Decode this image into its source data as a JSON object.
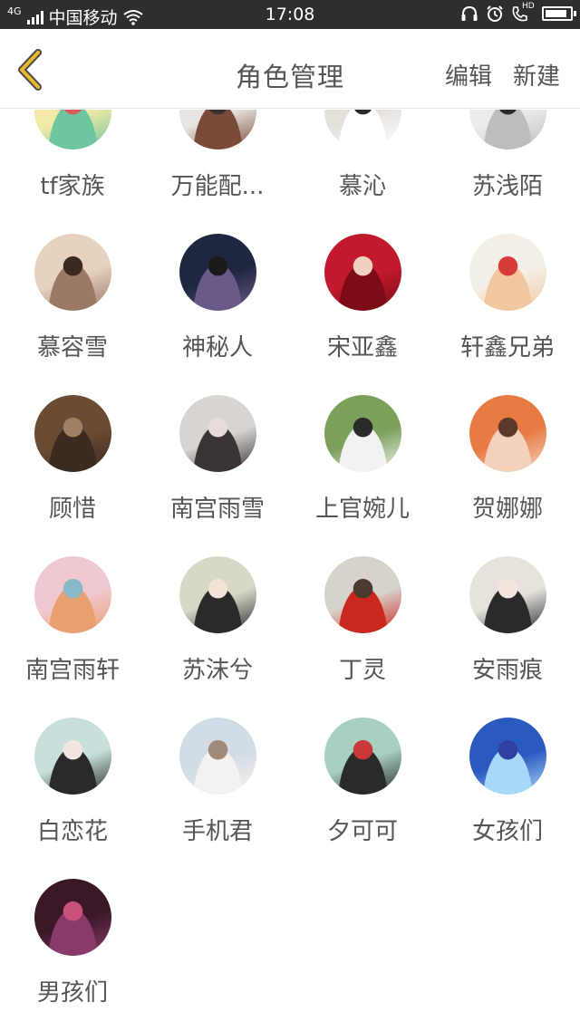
{
  "status_bar": {
    "network": "4G",
    "carrier": "中国移动",
    "time": "17:08",
    "hd": "HD",
    "icons": [
      "signal-icon",
      "wifi-icon",
      "headset-icon",
      "alarm-icon",
      "phone-hd-icon",
      "battery-icon"
    ]
  },
  "header": {
    "title": "角色管理",
    "edit_label": "编辑",
    "new_label": "新建",
    "back_icon": "chevron-left-icon",
    "accent_color": "#e6b92e"
  },
  "roles": [
    {
      "name": "tf家族",
      "avatar_colors": [
        "#f3e9a8",
        "#6ec6a0",
        "#d85a5a"
      ]
    },
    {
      "name": "万能配...",
      "avatar_colors": [
        "#e8e4e0",
        "#7a4a38",
        "#3a3030"
      ]
    },
    {
      "name": "慕沁",
      "avatar_colors": [
        "#e6e0da",
        "#ffffff",
        "#2b2b2b"
      ]
    },
    {
      "name": "苏浅陌",
      "avatar_colors": [
        "#ececec",
        "#bdbdbd",
        "#2a2a2a"
      ]
    },
    {
      "name": "慕容雪",
      "avatar_colors": [
        "#e6d2bf",
        "#9a7a66",
        "#3a2a22"
      ]
    },
    {
      "name": "神秘人",
      "avatar_colors": [
        "#1f2740",
        "#6a5a8a",
        "#1a1a1a"
      ]
    },
    {
      "name": "宋亚鑫",
      "avatar_colors": [
        "#c21a2c",
        "#7d0c18",
        "#f0d0c0"
      ]
    },
    {
      "name": "轩鑫兄弟",
      "avatar_colors": [
        "#f4efe6",
        "#f2c7a0",
        "#d83a3a"
      ]
    },
    {
      "name": "顾惜",
      "avatar_colors": [
        "#6a4c34",
        "#3a2a20",
        "#a08060"
      ]
    },
    {
      "name": "南宫雨雪",
      "avatar_colors": [
        "#d8d4d0",
        "#3a3434",
        "#e6ddd8"
      ]
    },
    {
      "name": "上官婉儿",
      "avatar_colors": [
        "#7aa05a",
        "#f2f2f2",
        "#2a2a2a"
      ]
    },
    {
      "name": "贺娜娜",
      "avatar_colors": [
        "#e87a44",
        "#f2d2bc",
        "#5a3a2a"
      ]
    },
    {
      "name": "南宫雨轩",
      "avatar_colors": [
        "#f0c8d0",
        "#e8a070",
        "#8ab8c8"
      ]
    },
    {
      "name": "苏沫兮",
      "avatar_colors": [
        "#d8d8c8",
        "#2a2a2a",
        "#f2e2d8"
      ]
    },
    {
      "name": "丁灵",
      "avatar_colors": [
        "#d8d2cc",
        "#c8281e",
        "#4a3a30"
      ]
    },
    {
      "name": "安雨痕",
      "avatar_colors": [
        "#e8e2dc",
        "#2a2a2a",
        "#f4e6de"
      ]
    },
    {
      "name": "白恋花",
      "avatar_colors": [
        "#c8e0dc",
        "#2a2a2a",
        "#f2e6e0"
      ]
    },
    {
      "name": "手机君",
      "avatar_colors": [
        "#d2dce4",
        "#f4f2f0",
        "#a08a7a"
      ]
    },
    {
      "name": "夕可可",
      "avatar_colors": [
        "#a8d0c0",
        "#2a2a2a",
        "#c83a3a"
      ]
    },
    {
      "name": "女孩们",
      "avatar_colors": [
        "#2a5ac0",
        "#a8d8f8",
        "#3040a0"
      ]
    },
    {
      "name": "男孩们",
      "avatar_colors": [
        "#3a1828",
        "#8a3a6a",
        "#c8507a"
      ]
    }
  ]
}
